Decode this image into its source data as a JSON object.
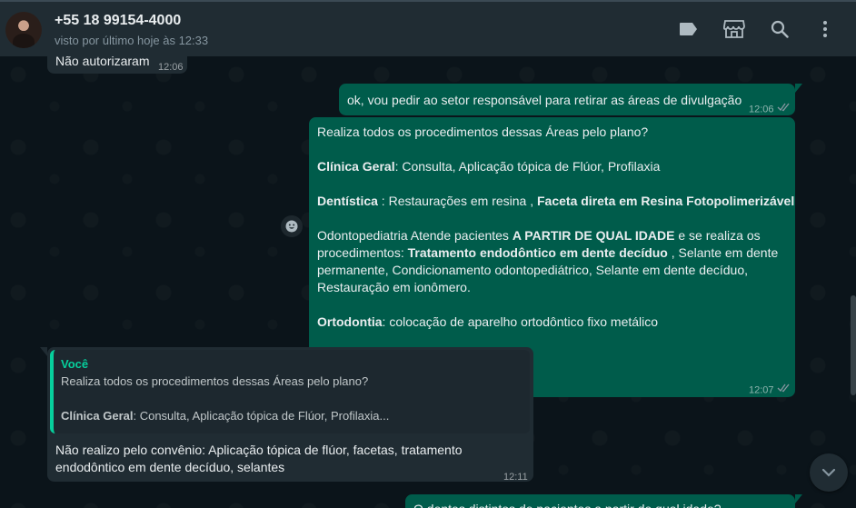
{
  "header": {
    "contact_name": "+55 18 99154-4000",
    "status": "visto por último hoje às 12:33",
    "icons": [
      "label-icon",
      "storefront-icon",
      "search-icon",
      "menu-icon"
    ]
  },
  "messages": {
    "m1": {
      "text": "Não autorizaram",
      "time": "12:06"
    },
    "m2": {
      "text": "ok, vou pedir ao setor responsável para retirar as áreas de divulgação",
      "time": "12:06"
    },
    "m3": {
      "q": "Realiza todos os procedimentos dessas Áreas pelo plano?",
      "l2_b": "Clínica Geral",
      "l2_t": ": Consulta, Aplicação tópica de Flúor, Profilaxia",
      "l3_b": "Dentística",
      "l3_t": " : Restaurações em resina , ",
      "l3_b2": "Faceta direta em Resina Fotopolimerizável",
      "l4_t": "Odontopediatria Atende pacientes ",
      "l4_b": "A PARTIR DE QUAL IDADE",
      "l4_t2": " e se realiza os",
      "l5_t": "procedimentos: ",
      "l5_b": "Tratamento endodôntico em dente decíduo",
      "l5_t2": " , Selante em dente",
      "l6_t": "permanente, Condicionamento odontopediátrico, Selante em dente decíduo,",
      "l7_t": "Restauração em ionômero.",
      "l8_b": "Ortodontia",
      "l8_t": ": colocação de aparelho ortodôntico fixo metálico",
      "time": "12:07"
    },
    "m4": {
      "quote_author": "Você",
      "quote_line1": "Realiza todos os procedimentos dessas Áreas pelo plano?",
      "quote_line2_b": "Clínica Geral",
      "quote_line2_t": ": Consulta, Aplicação tópica de Flúor, Profilaxia...",
      "line1": "Não realizo pelo convênio: Aplicação tópica de flúor, facetas, tratamento",
      "line2": "endodôntico em dente decíduo, selantes",
      "time": "12:11"
    },
    "m5": {
      "partial": "O dentes distintos de pacientes a partir de qual idade?"
    }
  },
  "colors": {
    "header_bg": "#202c33",
    "chat_bg": "#0b141a",
    "incoming_bubble": "#202c33",
    "outgoing_bubble": "#005c4b",
    "accent": "#06cf9c"
  }
}
